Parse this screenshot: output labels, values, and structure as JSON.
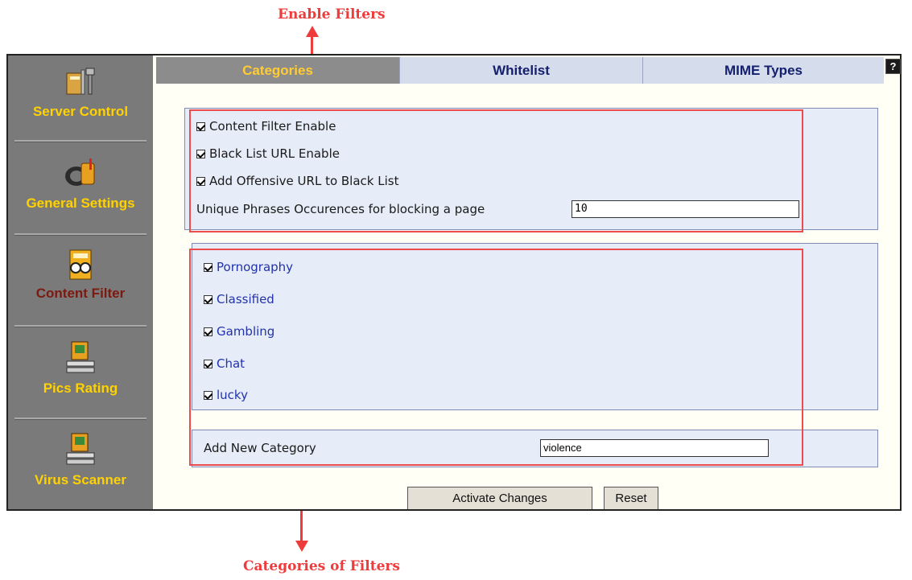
{
  "annotations": {
    "top_label": "Enable Filters",
    "bottom_label": "Categories of Filters"
  },
  "sidebar": {
    "items": [
      {
        "label": "Server Control",
        "icon": "server-control-icon"
      },
      {
        "label": "General Settings",
        "icon": "mailbox-icon"
      },
      {
        "label": "Content Filter",
        "icon": "content-filter-icon",
        "active": true
      },
      {
        "label": "Pics Rating",
        "icon": "pics-rating-icon"
      },
      {
        "label": "Virus Scanner",
        "icon": "virus-scanner-icon"
      }
    ]
  },
  "tabs": [
    {
      "label": "Categories",
      "active": true
    },
    {
      "label": "Whitelist"
    },
    {
      "label": "MIME Types"
    }
  ],
  "help_label": "?",
  "enable_panel": {
    "content_filter_enable": "Content Filter Enable",
    "black_list_url_enable": "Black List URL Enable",
    "add_offensive_url": "Add Offensive URL to Black List",
    "unique_phrases_label": "Unique Phrases Occurences for blocking a page",
    "unique_phrases_value": "10"
  },
  "categories": [
    {
      "label": "Pornography",
      "checked": true
    },
    {
      "label": "Classified",
      "checked": true
    },
    {
      "label": "Gambling",
      "checked": true
    },
    {
      "label": "Chat",
      "checked": true
    },
    {
      "label": "lucky",
      "checked": true
    }
  ],
  "add_category": {
    "label": "Add New Category",
    "value": "violence"
  },
  "buttons": {
    "activate": "Activate Changes",
    "reset": "Reset"
  },
  "colors": {
    "accent_red": "#ee3b3b",
    "sidebar_bg": "#7a7a7a",
    "sidebar_text": "#ffd200",
    "panel_bg": "#e6ecf8",
    "tab_inactive_text": "#14206e"
  }
}
